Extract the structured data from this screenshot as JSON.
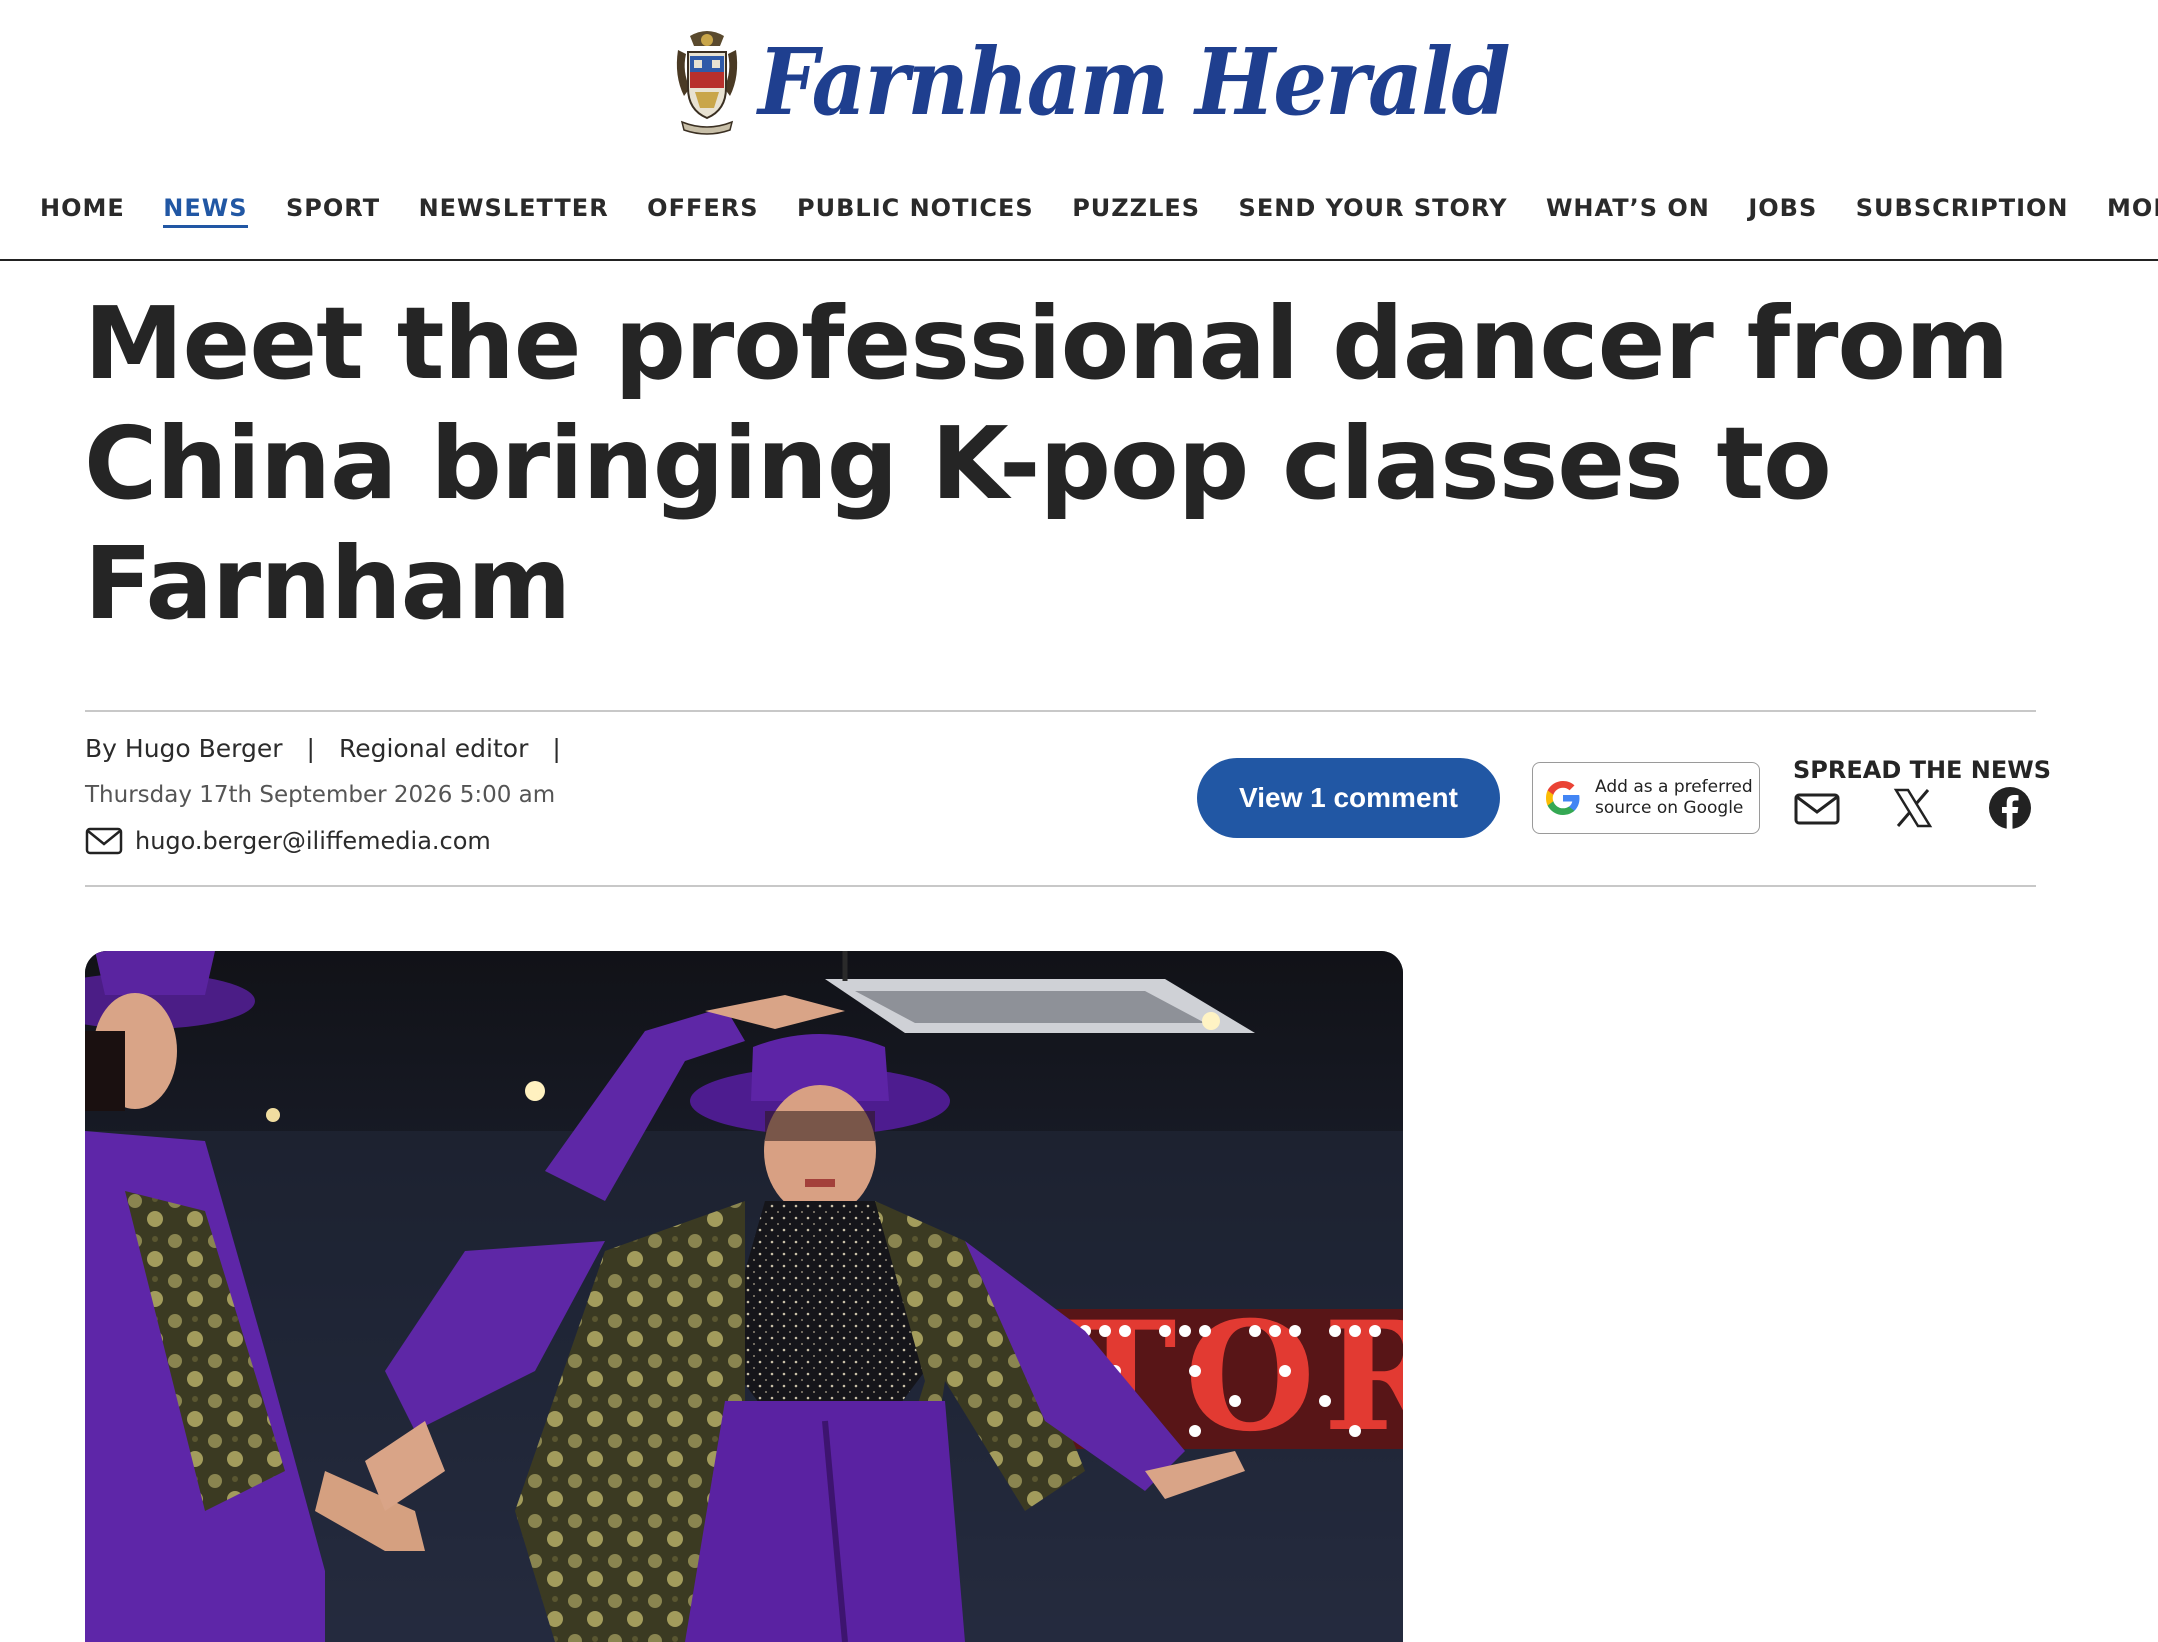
{
  "masthead": {
    "title": "Farnham Herald",
    "colors": {
      "brand": "#1f3f8f"
    },
    "crest_icon": "coat-of-arms"
  },
  "nav": {
    "items": [
      {
        "label": "HOME"
      },
      {
        "label": "NEWS",
        "active": true
      },
      {
        "label": "SPORT"
      },
      {
        "label": "NEWSLETTER"
      },
      {
        "label": "OFFERS"
      },
      {
        "label": "PUBLIC NOTICES"
      },
      {
        "label": "PUZZLES"
      },
      {
        "label": "SEND YOUR STORY"
      },
      {
        "label": "WHAT’S ON"
      },
      {
        "label": "JOBS"
      },
      {
        "label": "SUBSCRIPTION"
      },
      {
        "label": "MORE"
      }
    ],
    "colors": {
      "active": "#2157a4"
    }
  },
  "article": {
    "headline": "Meet the professional dancer from China bringing K-pop classes to Farnham",
    "author": "By Hugo Berger",
    "role": "Regional editor",
    "separator": "|",
    "date": "Thursday 17th September 2026 5:00 am",
    "email": "hugo.berger@iliffemedia.com"
  },
  "actions": {
    "comment_button": "View 1 comment",
    "google_button_line1": "Add as a preferred",
    "google_button_line2": "source on Google",
    "spread_label": "SPREAD THE NEWS",
    "share_icons": [
      "envelope-icon",
      "x-icon",
      "facebook-icon"
    ],
    "colors": {
      "button": "#2157a4"
    }
  },
  "hero": {
    "sign_text": "TOR"
  }
}
